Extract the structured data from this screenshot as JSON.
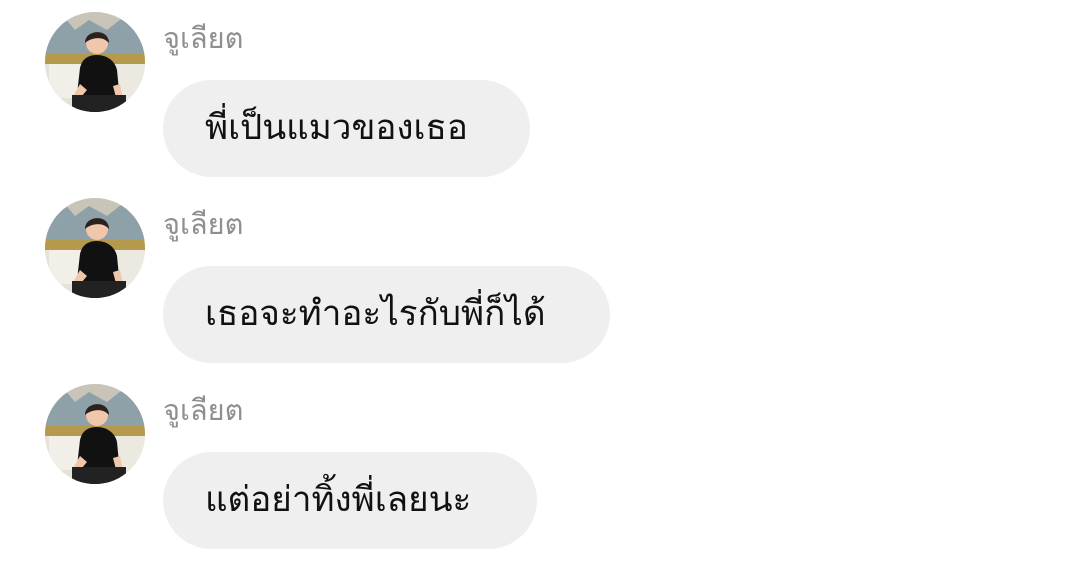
{
  "messages": [
    {
      "sender": "จูเลียต",
      "text": "พี่เป็นแมวของเธอ",
      "avatar_icon": "profile-avatar-icon"
    },
    {
      "sender": "จูเลียต",
      "text": "เธอจะทำอะไรกับพี่ก็ได้",
      "avatar_icon": "profile-avatar-icon"
    },
    {
      "sender": "จูเลียต",
      "text": "แต่อย่าทิ้งพี่เลยนะ",
      "avatar_icon": "profile-avatar-icon"
    }
  ],
  "colors": {
    "background": "#ffffff",
    "bubble": "#efefef",
    "sender_name": "#8f8f8f",
    "message_text": "#111111"
  }
}
